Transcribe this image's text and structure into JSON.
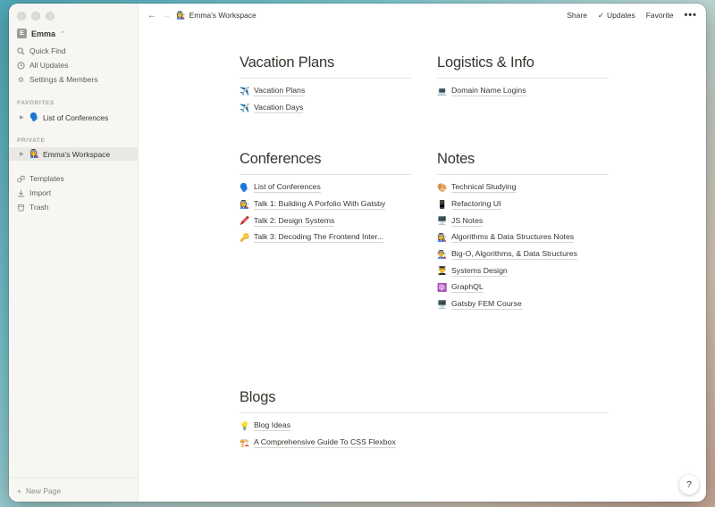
{
  "sidebar": {
    "workspace_avatar": "E",
    "workspace_name": "Emma",
    "top_items": [
      {
        "label": "Quick Find",
        "icon": "search-icon"
      },
      {
        "label": "All Updates",
        "icon": "clock-icon"
      },
      {
        "label": "Settings & Members",
        "icon": "gear-icon"
      }
    ],
    "favorites_label": "FAVORITES",
    "favorites": [
      {
        "emoji": "🗣️",
        "label": "List of Conferences"
      }
    ],
    "private_label": "PRIVATE",
    "private": [
      {
        "emoji": "👩‍🏭",
        "label": "Emma's Workspace"
      }
    ],
    "bottom_items": [
      {
        "label": "Templates",
        "icon": "shapes-icon"
      },
      {
        "label": "Import",
        "icon": "download-icon"
      },
      {
        "label": "Trash",
        "icon": "trash-icon"
      }
    ],
    "new_page_label": "New Page"
  },
  "topbar": {
    "page_emoji": "👩‍🏭",
    "page_title": "Emma's Workspace",
    "share_label": "Share",
    "updates_label": "Updates",
    "favorite_label": "Favorite"
  },
  "sections": {
    "vacation": {
      "title": "Vacation Plans",
      "links": [
        {
          "emoji": "✈️",
          "label": "Vacation Plans"
        },
        {
          "emoji": "✈️",
          "label": "Vacation Days"
        }
      ]
    },
    "logistics": {
      "title": "Logistics & Info",
      "links": [
        {
          "emoji": "💻",
          "label": "Domain Name Logins"
        }
      ]
    },
    "conferences": {
      "title": "Conferences",
      "links": [
        {
          "emoji": "🗣️",
          "label": "List of Conferences"
        },
        {
          "emoji": "👩‍🏭",
          "label": "Talk 1: Building A Porfolio With Gatsby"
        },
        {
          "emoji": "🖍️",
          "label": "Talk 2: Design Systems"
        },
        {
          "emoji": "🔑",
          "label": "Talk 3: Decoding The Frontend Inter..."
        }
      ]
    },
    "notes": {
      "title": "Notes",
      "links": [
        {
          "emoji": "🎨",
          "label": "Technical Studying"
        },
        {
          "emoji": "📱",
          "label": "Refactoring UI"
        },
        {
          "emoji": "🖥️",
          "label": "JS Notes"
        },
        {
          "emoji": "👩‍🏭",
          "label": "Algorithms & Data Structures Notes"
        },
        {
          "emoji": "👨‍🏭",
          "label": "Big-O, Algorithms, & Data Structures"
        },
        {
          "emoji": "👨‍🎓",
          "label": "Systems Design"
        },
        {
          "emoji": "⚛️",
          "label": "GraphQL"
        },
        {
          "emoji": "🖥️",
          "label": "Gatsby FEM Course"
        }
      ]
    },
    "blogs": {
      "title": "Blogs",
      "links": [
        {
          "emoji": "💡",
          "label": "Blog Ideas"
        },
        {
          "emoji": "🏗️",
          "label": "A Comprehensive Guide To CSS Flexbox"
        }
      ]
    }
  },
  "help_label": "?"
}
